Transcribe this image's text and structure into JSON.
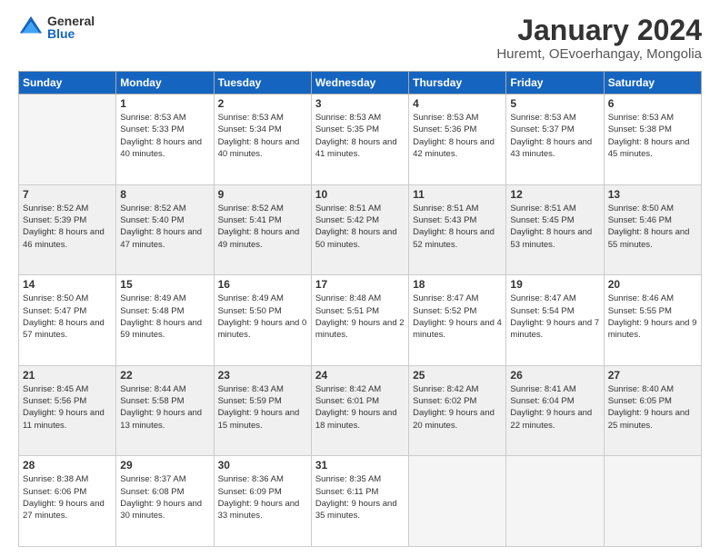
{
  "logo": {
    "general": "General",
    "blue": "Blue"
  },
  "title": "January 2024",
  "location": "Huremt, OEvoerhangay, Mongolia",
  "days_header": [
    "Sunday",
    "Monday",
    "Tuesday",
    "Wednesday",
    "Thursday",
    "Friday",
    "Saturday"
  ],
  "weeks": [
    {
      "shaded": false,
      "days": [
        {
          "num": "",
          "empty": true
        },
        {
          "num": "1",
          "sunrise": "8:53 AM",
          "sunset": "5:33 PM",
          "daylight": "8 hours and 40 minutes."
        },
        {
          "num": "2",
          "sunrise": "8:53 AM",
          "sunset": "5:34 PM",
          "daylight": "8 hours and 40 minutes."
        },
        {
          "num": "3",
          "sunrise": "8:53 AM",
          "sunset": "5:35 PM",
          "daylight": "8 hours and 41 minutes."
        },
        {
          "num": "4",
          "sunrise": "8:53 AM",
          "sunset": "5:36 PM",
          "daylight": "8 hours and 42 minutes."
        },
        {
          "num": "5",
          "sunrise": "8:53 AM",
          "sunset": "5:37 PM",
          "daylight": "8 hours and 43 minutes."
        },
        {
          "num": "6",
          "sunrise": "8:53 AM",
          "sunset": "5:38 PM",
          "daylight": "8 hours and 45 minutes."
        }
      ]
    },
    {
      "shaded": true,
      "days": [
        {
          "num": "7",
          "sunrise": "8:52 AM",
          "sunset": "5:39 PM",
          "daylight": "8 hours and 46 minutes."
        },
        {
          "num": "8",
          "sunrise": "8:52 AM",
          "sunset": "5:40 PM",
          "daylight": "8 hours and 47 minutes."
        },
        {
          "num": "9",
          "sunrise": "8:52 AM",
          "sunset": "5:41 PM",
          "daylight": "8 hours and 49 minutes."
        },
        {
          "num": "10",
          "sunrise": "8:51 AM",
          "sunset": "5:42 PM",
          "daylight": "8 hours and 50 minutes."
        },
        {
          "num": "11",
          "sunrise": "8:51 AM",
          "sunset": "5:43 PM",
          "daylight": "8 hours and 52 minutes."
        },
        {
          "num": "12",
          "sunrise": "8:51 AM",
          "sunset": "5:45 PM",
          "daylight": "8 hours and 53 minutes."
        },
        {
          "num": "13",
          "sunrise": "8:50 AM",
          "sunset": "5:46 PM",
          "daylight": "8 hours and 55 minutes."
        }
      ]
    },
    {
      "shaded": false,
      "days": [
        {
          "num": "14",
          "sunrise": "8:50 AM",
          "sunset": "5:47 PM",
          "daylight": "8 hours and 57 minutes."
        },
        {
          "num": "15",
          "sunrise": "8:49 AM",
          "sunset": "5:48 PM",
          "daylight": "8 hours and 59 minutes."
        },
        {
          "num": "16",
          "sunrise": "8:49 AM",
          "sunset": "5:50 PM",
          "daylight": "9 hours and 0 minutes."
        },
        {
          "num": "17",
          "sunrise": "8:48 AM",
          "sunset": "5:51 PM",
          "daylight": "9 hours and 2 minutes."
        },
        {
          "num": "18",
          "sunrise": "8:47 AM",
          "sunset": "5:52 PM",
          "daylight": "9 hours and 4 minutes."
        },
        {
          "num": "19",
          "sunrise": "8:47 AM",
          "sunset": "5:54 PM",
          "daylight": "9 hours and 7 minutes."
        },
        {
          "num": "20",
          "sunrise": "8:46 AM",
          "sunset": "5:55 PM",
          "daylight": "9 hours and 9 minutes."
        }
      ]
    },
    {
      "shaded": true,
      "days": [
        {
          "num": "21",
          "sunrise": "8:45 AM",
          "sunset": "5:56 PM",
          "daylight": "9 hours and 11 minutes."
        },
        {
          "num": "22",
          "sunrise": "8:44 AM",
          "sunset": "5:58 PM",
          "daylight": "9 hours and 13 minutes."
        },
        {
          "num": "23",
          "sunrise": "8:43 AM",
          "sunset": "5:59 PM",
          "daylight": "9 hours and 15 minutes."
        },
        {
          "num": "24",
          "sunrise": "8:42 AM",
          "sunset": "6:01 PM",
          "daylight": "9 hours and 18 minutes."
        },
        {
          "num": "25",
          "sunrise": "8:42 AM",
          "sunset": "6:02 PM",
          "daylight": "9 hours and 20 minutes."
        },
        {
          "num": "26",
          "sunrise": "8:41 AM",
          "sunset": "6:04 PM",
          "daylight": "9 hours and 22 minutes."
        },
        {
          "num": "27",
          "sunrise": "8:40 AM",
          "sunset": "6:05 PM",
          "daylight": "9 hours and 25 minutes."
        }
      ]
    },
    {
      "shaded": false,
      "days": [
        {
          "num": "28",
          "sunrise": "8:38 AM",
          "sunset": "6:06 PM",
          "daylight": "9 hours and 27 minutes."
        },
        {
          "num": "29",
          "sunrise": "8:37 AM",
          "sunset": "6:08 PM",
          "daylight": "9 hours and 30 minutes."
        },
        {
          "num": "30",
          "sunrise": "8:36 AM",
          "sunset": "6:09 PM",
          "daylight": "9 hours and 33 minutes."
        },
        {
          "num": "31",
          "sunrise": "8:35 AM",
          "sunset": "6:11 PM",
          "daylight": "9 hours and 35 minutes."
        },
        {
          "num": "",
          "empty": true
        },
        {
          "num": "",
          "empty": true
        },
        {
          "num": "",
          "empty": true
        }
      ]
    }
  ]
}
